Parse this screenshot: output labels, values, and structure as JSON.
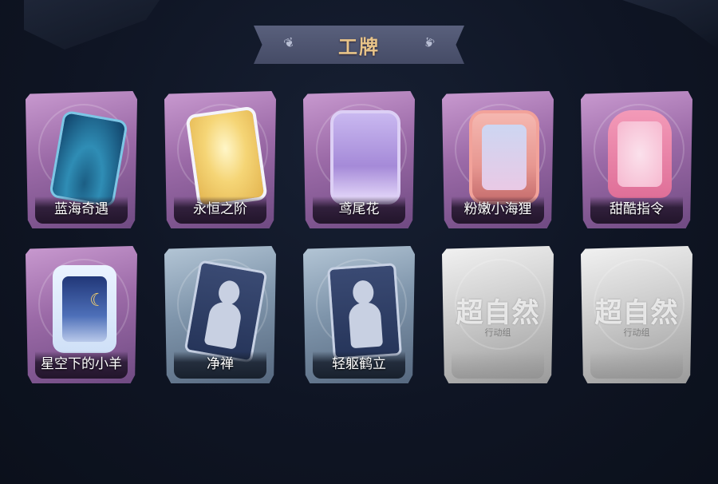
{
  "title": "工牌",
  "cards": [
    {
      "name": "蓝海奇遇",
      "style": "purple",
      "art": "ocean-card-art"
    },
    {
      "name": "永恒之阶",
      "style": "purple",
      "art": "golden-frame-art"
    },
    {
      "name": "鸢尾花",
      "style": "purple",
      "art": "iris-frame-art"
    },
    {
      "name": "粉嫩小海狸",
      "style": "purple",
      "art": "pink-seal-art"
    },
    {
      "name": "甜酷指令",
      "style": "purple",
      "art": "pink-shark-art"
    },
    {
      "name": "星空下的小羊",
      "style": "purple",
      "art": "starry-sheep-art"
    },
    {
      "name": "净禅",
      "style": "blue",
      "art": "silhouette-art"
    },
    {
      "name": "轻躯鹤立",
      "style": "blue",
      "art": "silhouette-art"
    },
    {
      "name": "",
      "style": "gray",
      "art": "locked-placeholder"
    },
    {
      "name": "",
      "style": "gray",
      "art": "locked-placeholder"
    }
  ],
  "placeholder_logo": {
    "main": "超自然",
    "sub": "行动组"
  }
}
